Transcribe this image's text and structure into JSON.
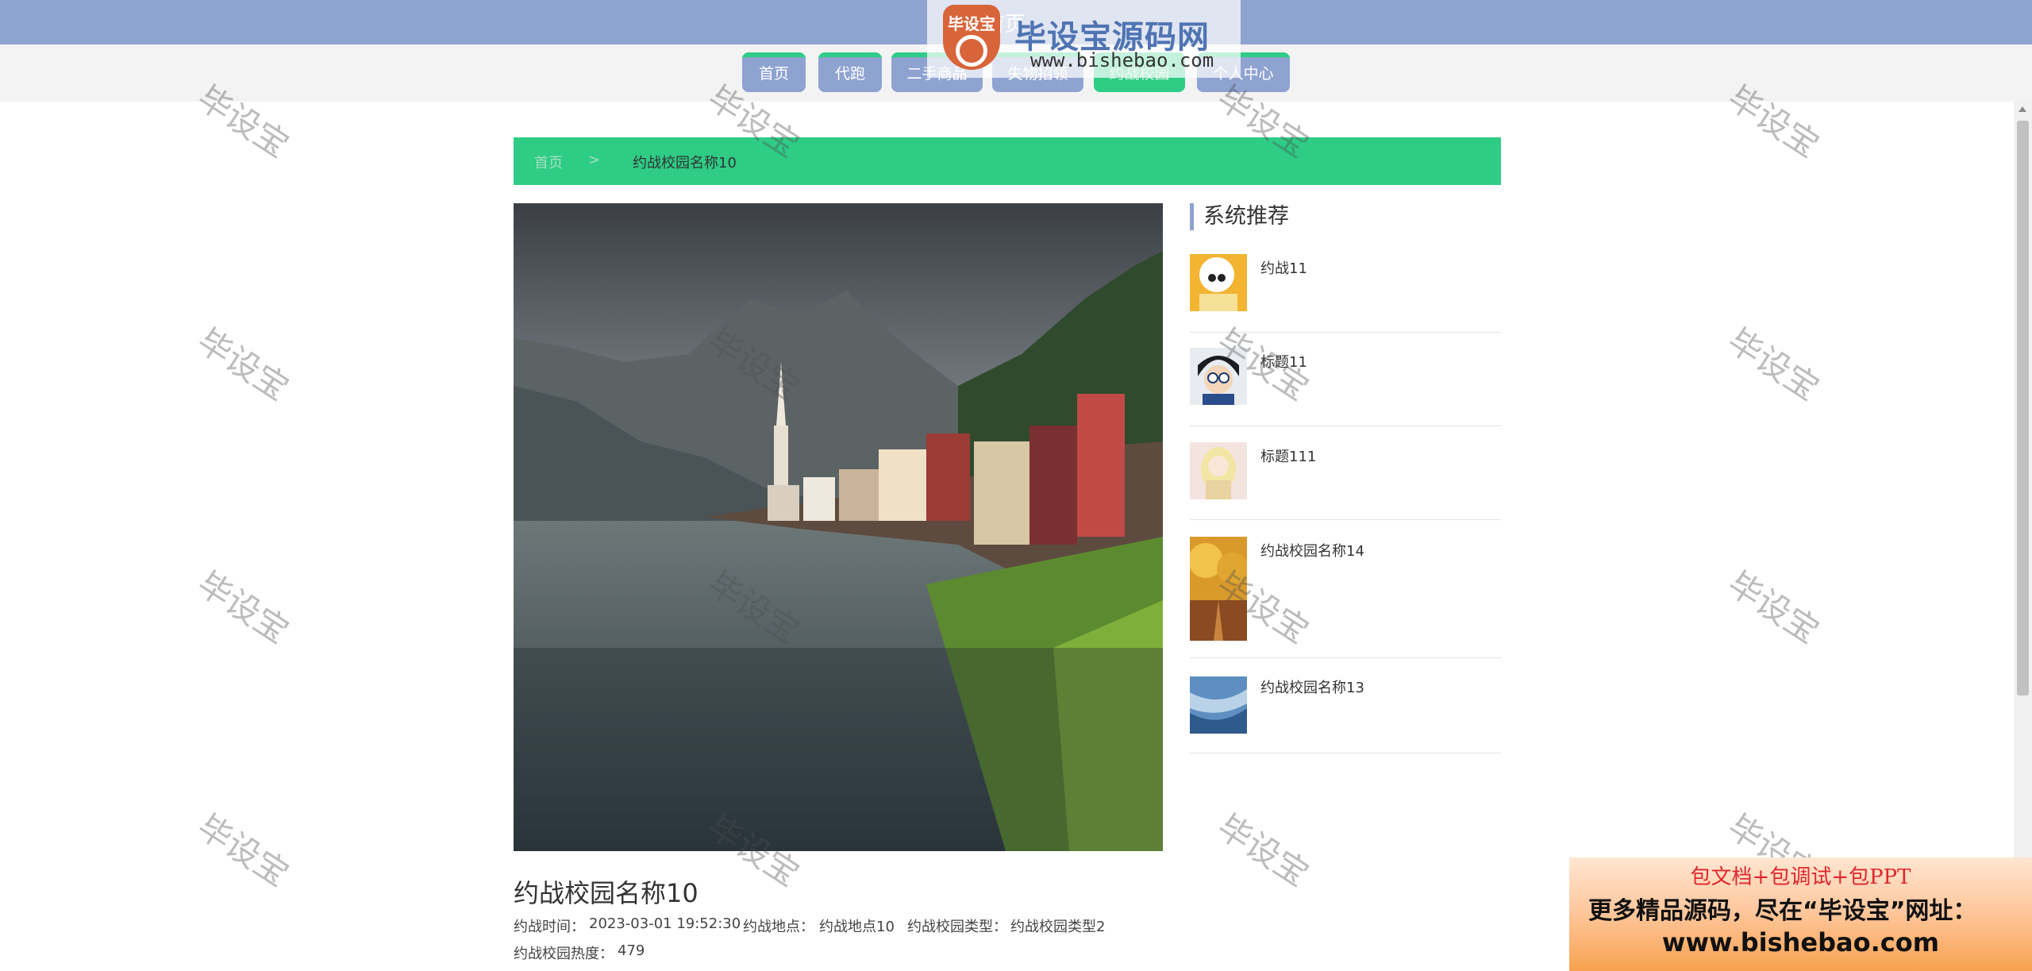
{
  "header": {
    "site_title": "首页",
    "logo": {
      "title": "毕设宝源码网",
      "url": "www.bishebao.com",
      "emblem_text": "毕设宝"
    },
    "nav": [
      {
        "label": "首页"
      },
      {
        "label": "代跑"
      },
      {
        "label": "二手商品"
      },
      {
        "label": "失物招领"
      },
      {
        "label": "约战校园"
      },
      {
        "label": "个人中心"
      }
    ]
  },
  "breadcrumb": {
    "home": "首页",
    "separator": ">",
    "current": "约战校园名称10"
  },
  "detail": {
    "title": "约战校园名称10",
    "time_label": "约战时间：",
    "time_value": "2023-03-01 19:52:30",
    "location_label": "约战地点：",
    "location_value": "约战地点10",
    "type_label": "约战校园类型：",
    "type_value": "约战校园类型2",
    "heat_label": "约战校园热度：",
    "heat_value": "479"
  },
  "sidebar": {
    "heading": "系统推荐",
    "items": [
      {
        "title": "约战11"
      },
      {
        "title": "标题11"
      },
      {
        "title": "标题111"
      },
      {
        "title": "约战校园名称14"
      },
      {
        "title": "约战校园名称13"
      }
    ]
  },
  "watermark": {
    "text": "毕设宝"
  },
  "ad": {
    "line1": "包文档+包调试+包PPT",
    "line2": "更多精品源码，尽在“毕设宝”网址：",
    "line3": "www.bishebao.com"
  },
  "colors": {
    "accent": "#2ecc85",
    "brand": "#8fa3d1"
  }
}
